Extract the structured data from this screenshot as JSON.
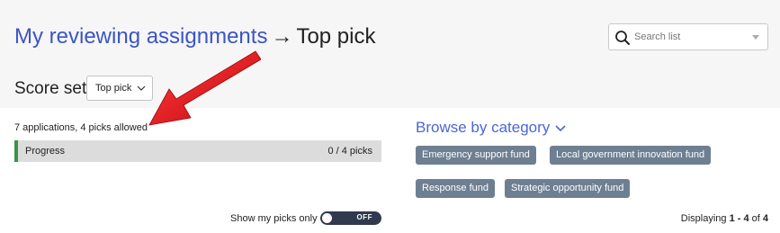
{
  "breadcrumb": {
    "parent": "My reviewing assignments",
    "separator": "→",
    "current": "Top pick"
  },
  "search": {
    "placeholder": "Search list"
  },
  "score_set": {
    "label": "Score set",
    "selected": "Top pick"
  },
  "summary": {
    "applications_text": "7 applications, 4 picks allowed"
  },
  "progress": {
    "label": "Progress",
    "count_text": "0 / 4 picks",
    "value": 0,
    "color": "#3f8f4a"
  },
  "picks_toggle": {
    "label": "Show my picks only",
    "state_text": "OFF"
  },
  "browse": {
    "title": "Browse by category",
    "categories": [
      "Emergency support fund",
      "Local government innovation fund",
      "Response fund",
      "Strategic opportunity fund"
    ]
  },
  "pagination": {
    "prefix": "Displaying ",
    "range": "1 - 4",
    "of": " of ",
    "total": "4"
  },
  "colors": {
    "link": "#3b55c7",
    "tag_bg": "#6e7f92",
    "annotation_arrow": "#e0151b"
  }
}
